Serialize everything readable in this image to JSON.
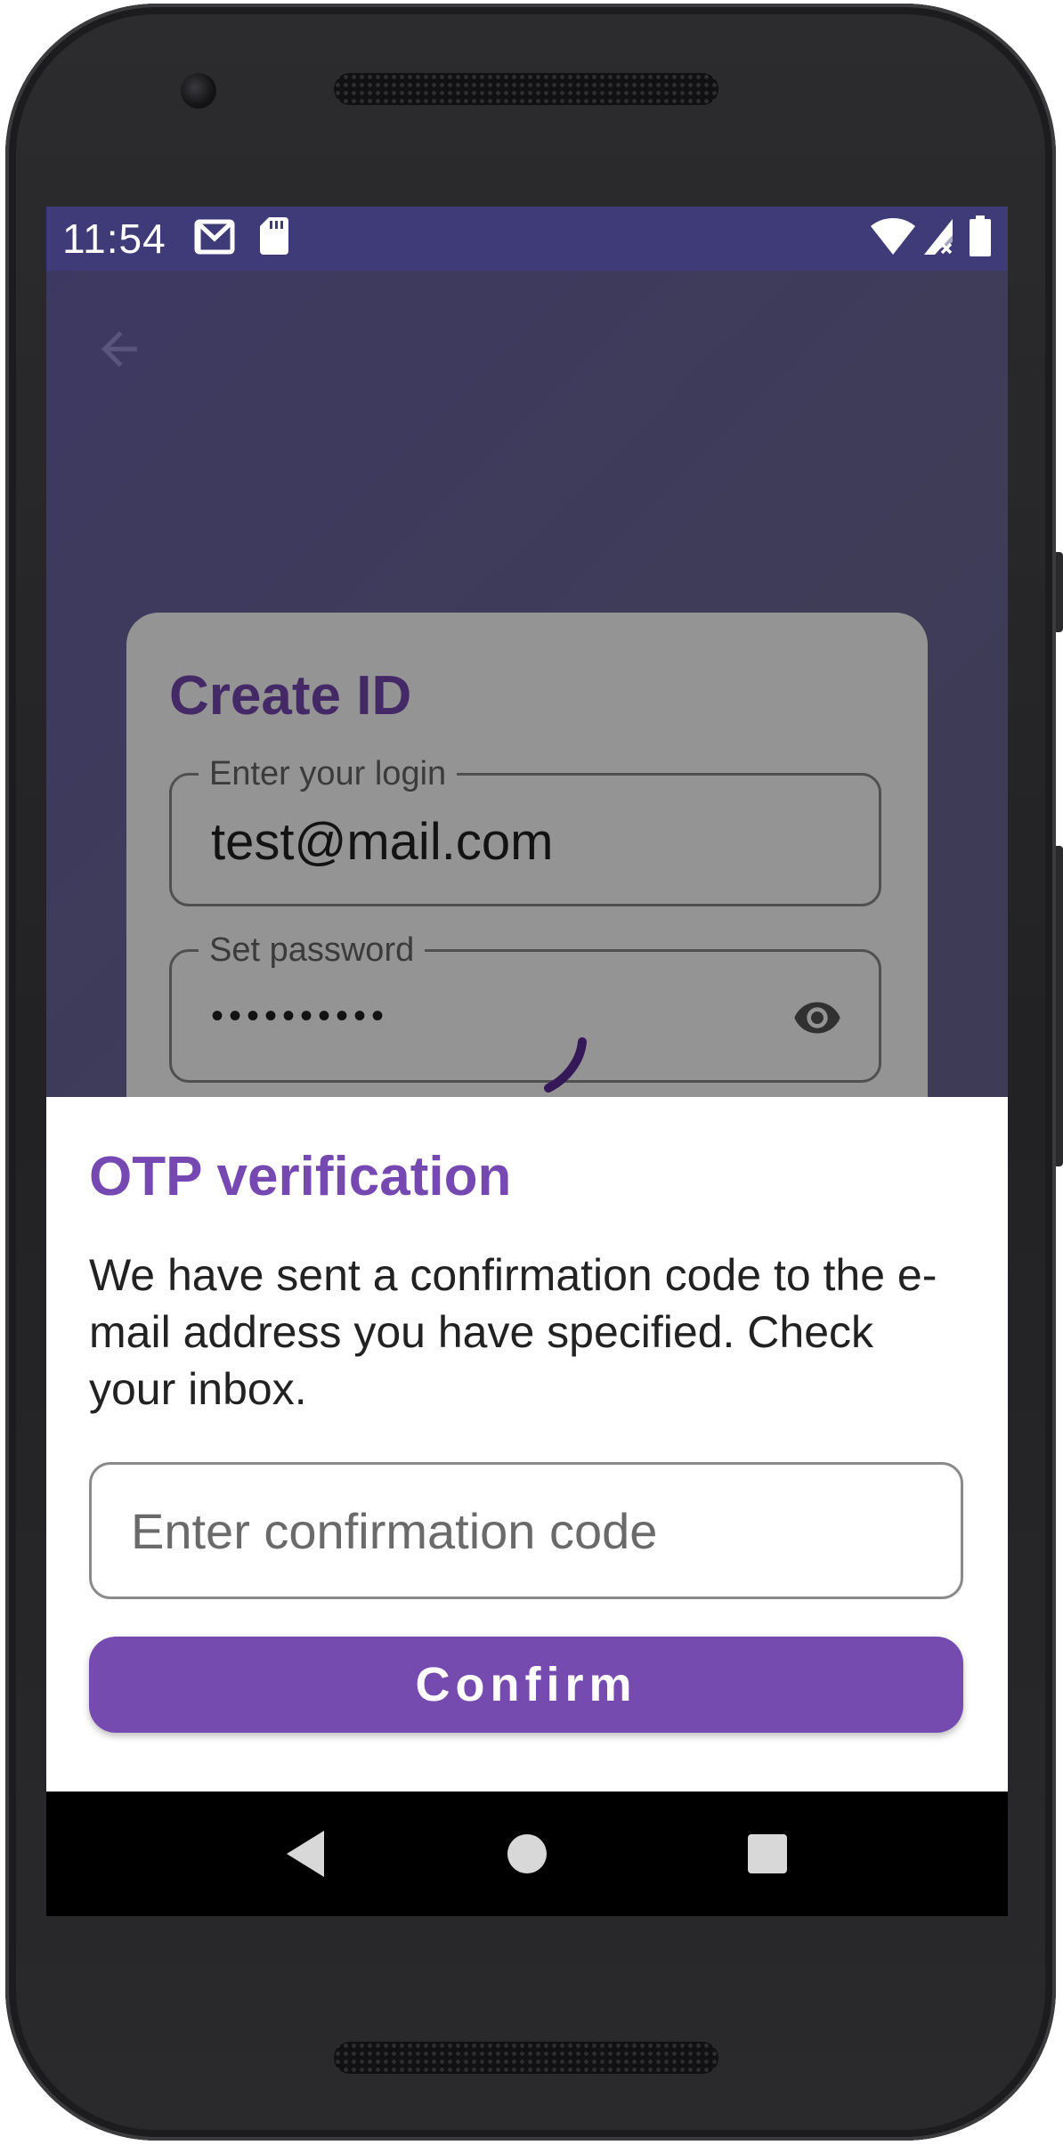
{
  "status_bar": {
    "time": "11:54",
    "icons": [
      "gmail-icon",
      "sd-card-icon",
      "wifi-icon",
      "signal-icon",
      "battery-icon"
    ]
  },
  "background_screen": {
    "back_icon": "arrow-back-icon",
    "card": {
      "title": "Create ID",
      "login_field": {
        "label": "Enter your login",
        "value": "test@mail.com"
      },
      "password_field": {
        "label": "Set password",
        "value": "••••••••••",
        "toggle_icon": "eye-icon"
      }
    }
  },
  "otp_sheet": {
    "title": "OTP verification",
    "message": "We have sent a confirmation code to the e-mail address you have specified. Check your inbox.",
    "code_input": {
      "placeholder": "Enter confirmation code",
      "value": ""
    },
    "confirm_label": "Confirm"
  },
  "nav_bar": {
    "buttons": [
      "back-triangle-icon",
      "home-circle-icon",
      "recents-square-icon"
    ]
  },
  "colors": {
    "accent": "#764bb0",
    "status_bar": "#3f3a78",
    "text": "#222222"
  }
}
